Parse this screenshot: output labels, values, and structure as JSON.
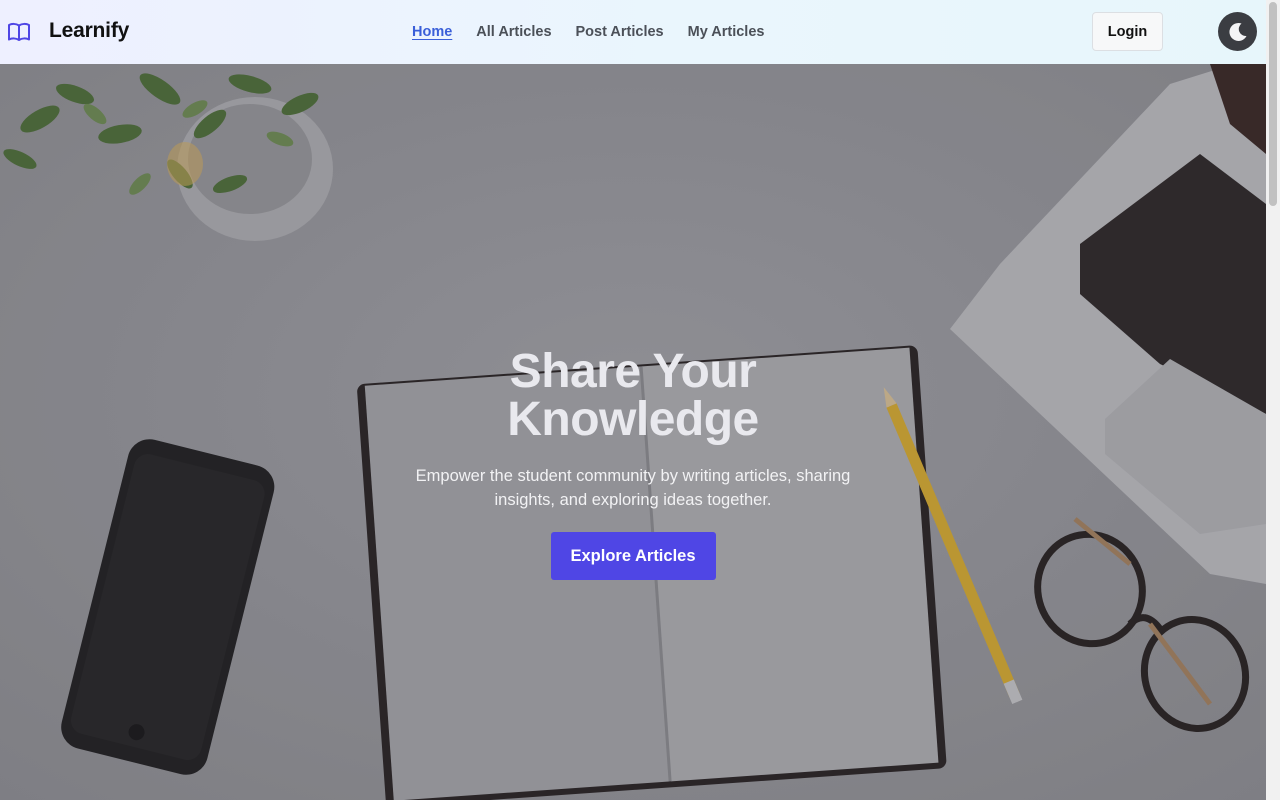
{
  "brand": {
    "name": "Learnify",
    "logo_icon": "open-book-icon",
    "accent_color": "#4f46e5"
  },
  "nav": {
    "links": [
      {
        "label": "Home",
        "active": true
      },
      {
        "label": "All Articles",
        "active": false
      },
      {
        "label": "Post Articles",
        "active": false
      },
      {
        "label": "My Articles",
        "active": false
      }
    ],
    "login_label": "Login",
    "theme_toggle_icon": "moon-icon"
  },
  "hero": {
    "title": "Share Your Knowledge",
    "subtitle": "Empower the student community by writing articles, sharing insights, and exploring ideas together.",
    "cta_label": "Explore Articles",
    "cta_color": "#4f46e5"
  }
}
